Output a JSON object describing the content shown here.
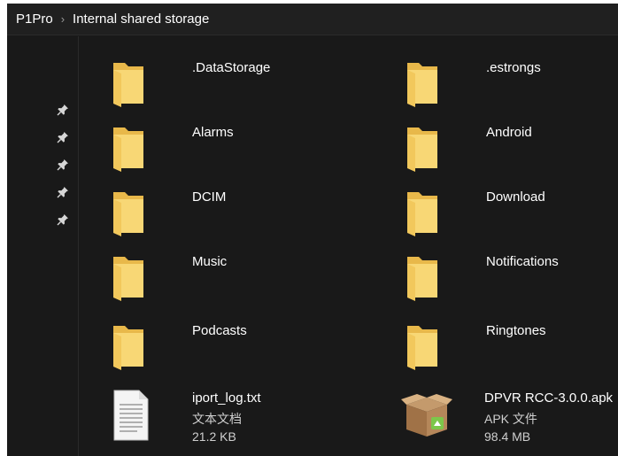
{
  "breadcrumb": {
    "device": "P1Pro",
    "separator": "›",
    "location": "Internal shared storage"
  },
  "quick_access_pins": 5,
  "colors": {
    "window_bg": "#191919",
    "folder_yellow": "#f8d775",
    "text": "#ffffff"
  },
  "items": [
    {
      "name": ".DataStorage",
      "icon": "folder-icon"
    },
    {
      "name": ".estrongs",
      "icon": "folder-icon"
    },
    {
      "name": "Alarms",
      "icon": "folder-icon"
    },
    {
      "name": "Android",
      "icon": "folder-icon"
    },
    {
      "name": "DCIM",
      "icon": "folder-icon"
    },
    {
      "name": "Download",
      "icon": "folder-icon"
    },
    {
      "name": "Music",
      "icon": "folder-icon"
    },
    {
      "name": "Notifications",
      "icon": "folder-icon"
    },
    {
      "name": "Podcasts",
      "icon": "folder-icon"
    },
    {
      "name": "Ringtones",
      "icon": "folder-icon"
    }
  ],
  "files": [
    {
      "name": "iport_log.txt",
      "type": "文本文档",
      "size": "21.2 KB",
      "icon": "text-file-icon"
    },
    {
      "name": "DPVR RCC-3.0.0.apk",
      "type": "APK 文件",
      "size": "98.4 MB",
      "icon": "apk-package-icon"
    }
  ]
}
